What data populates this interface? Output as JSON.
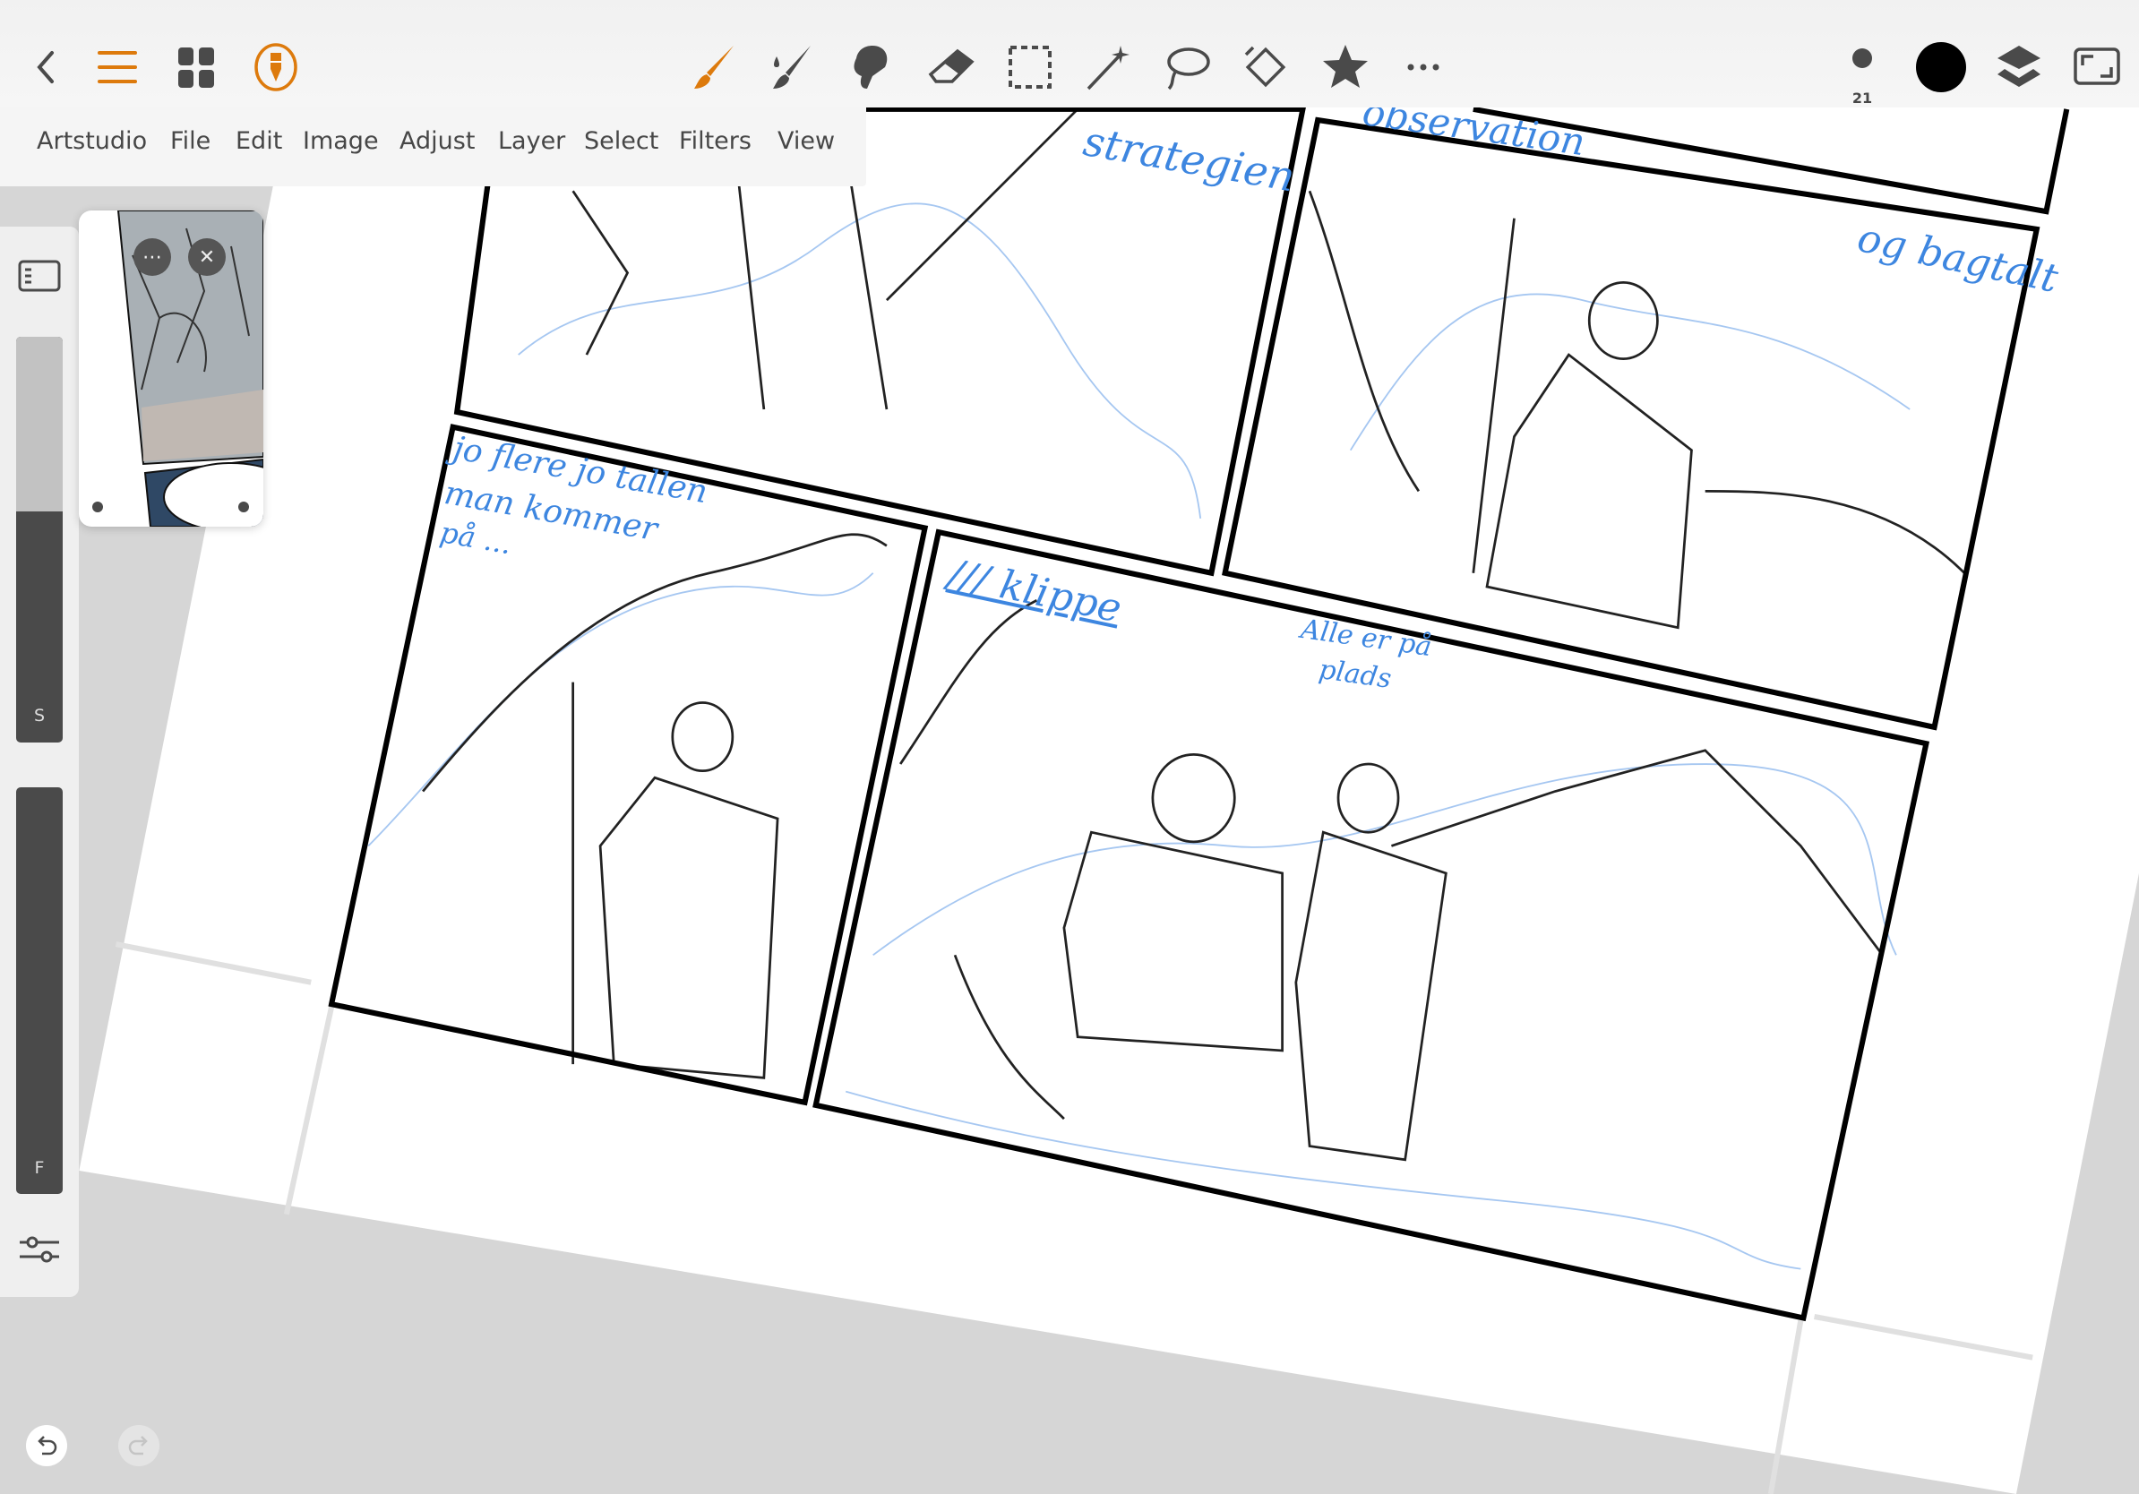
{
  "menu": [
    "Artstudio",
    "File",
    "Edit",
    "Image",
    "Adjust",
    "Layer",
    "Select",
    "Filters",
    "View"
  ],
  "toolbar": {
    "left_icons": [
      "back-icon",
      "menu-icon",
      "gallery-grid-icon",
      "pen-tool-icon"
    ],
    "tools": [
      "brush-icon",
      "smudge-icon",
      "blend-icon",
      "eraser-icon",
      "rect-select-icon",
      "magic-wand-icon",
      "lasso-icon",
      "transform-icon",
      "favorites-star-icon",
      "more-icon"
    ],
    "brush_size": "21",
    "active_color": "#000000",
    "accent": "#dd7a0c"
  },
  "sidebar": {
    "size_slider_label": "S",
    "size_slider_value": 0.57,
    "flow_slider_label": "F",
    "flow_slider_value": 1.0
  },
  "annotations": {
    "panel1": "strategien",
    "panel2_top": "observation",
    "panel2_side": "og bagtalt",
    "panel3": [
      "jo flere jo tallen",
      "man kommer",
      "på ..."
    ],
    "panel4_left": "/// klippe",
    "panel4_right": [
      "Alle er på",
      "plads"
    ]
  }
}
